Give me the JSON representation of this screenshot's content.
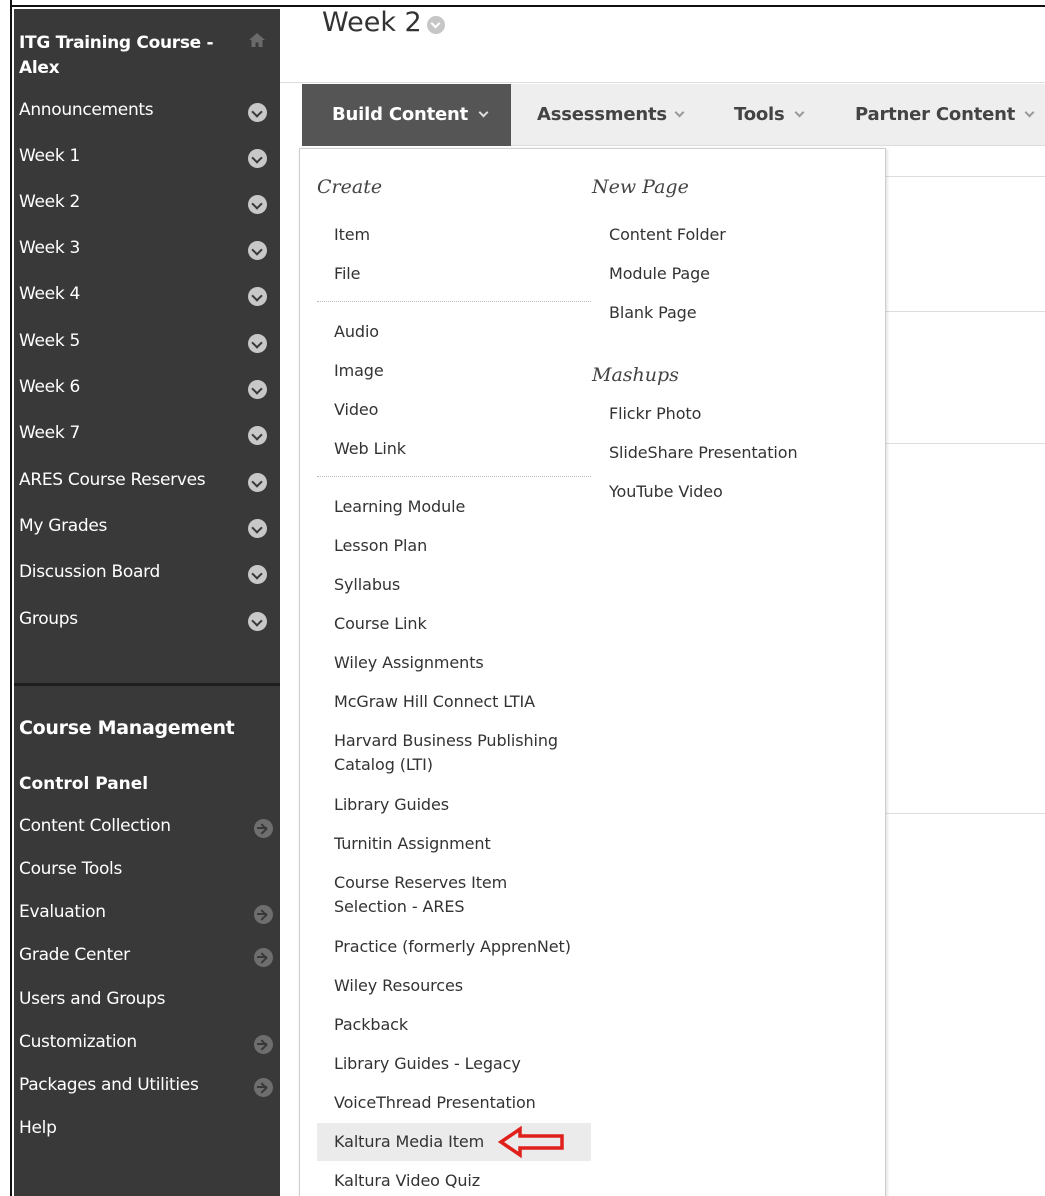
{
  "sidebar": {
    "course_title": "ITG Training Course - Alex",
    "items": [
      {
        "label": "Announcements"
      },
      {
        "label": "Week 1"
      },
      {
        "label": "Week 2"
      },
      {
        "label": "Week 3"
      },
      {
        "label": "Week 4"
      },
      {
        "label": "Week 5"
      },
      {
        "label": "Week 6"
      },
      {
        "label": "Week 7"
      },
      {
        "label": "ARES Course Reserves"
      },
      {
        "label": "My Grades"
      },
      {
        "label": "Discussion Board"
      },
      {
        "label": "Groups"
      }
    ],
    "management_title": "Course Management",
    "control_panel_title": "Control Panel",
    "control_panel_items": [
      {
        "label": "Content Collection",
        "has_arrow": true
      },
      {
        "label": "Course Tools",
        "has_arrow": false
      },
      {
        "label": "Evaluation",
        "has_arrow": true
      },
      {
        "label": "Grade Center",
        "has_arrow": true
      },
      {
        "label": "Users and Groups",
        "has_arrow": false
      },
      {
        "label": "Customization",
        "has_arrow": true
      },
      {
        "label": "Packages and Utilities",
        "has_arrow": true
      },
      {
        "label": "Help",
        "has_arrow": false
      }
    ]
  },
  "header": {
    "page_title": "Week 2"
  },
  "toolbar": {
    "build_content": "Build Content",
    "assessments": "Assessments",
    "tools": "Tools",
    "partner_content": "Partner Content"
  },
  "dropdown": {
    "create_heading": "Create",
    "create_group1": [
      "Item",
      "File"
    ],
    "create_group2": [
      "Audio",
      "Image",
      "Video",
      "Web Link"
    ],
    "create_group3": [
      "Learning Module",
      "Lesson Plan",
      "Syllabus",
      "Course Link",
      "Wiley Assignments",
      "McGraw Hill Connect LTIA",
      "Harvard Business Publishing Catalog (LTI)",
      "Library Guides",
      "Turnitin Assignment",
      "Course Reserves Item Selection - ARES",
      "Practice (formerly ApprenNet)",
      "Wiley Resources",
      "Packback",
      "Library Guides - Legacy",
      "VoiceThread Presentation",
      "Kaltura Media Item",
      "Kaltura Video Quiz"
    ],
    "highlighted_item": "Kaltura Media Item",
    "new_page_heading": "New Page",
    "new_page_items": [
      "Content Folder",
      "Module Page",
      "Blank Page"
    ],
    "mashups_heading": "Mashups",
    "mashups_items": [
      "Flickr Photo",
      "SlideShare Presentation",
      "YouTube Video"
    ]
  },
  "colors": {
    "sidebar_bg": "#393939",
    "active_tab_bg": "#555555",
    "toolbar_bg": "#eeeeee",
    "annotation_arrow": "#e0201b"
  }
}
